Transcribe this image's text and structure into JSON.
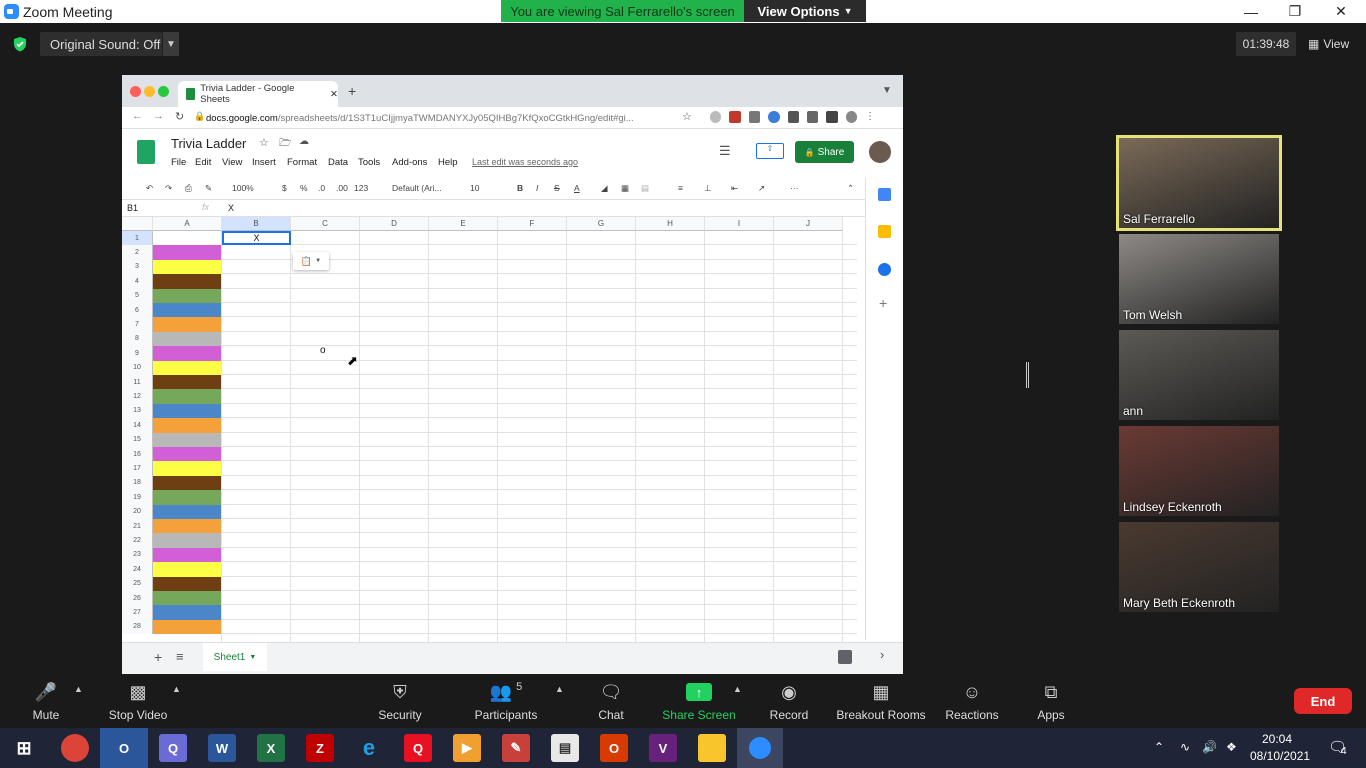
{
  "window": {
    "title": "Zoom Meeting",
    "minimize": "—",
    "maximize": "❐",
    "close": "✕"
  },
  "banner": {
    "viewing": "You are viewing Sal Ferrarello's screen",
    "view_options": "View Options"
  },
  "topbar": {
    "original_sound": "Original Sound: Off",
    "timer": "01:39:48",
    "view": "View"
  },
  "browser": {
    "tab_title": "Trivia Ladder - Google Sheets",
    "url_host": "docs.google.com",
    "url_path": "/spreadsheets/d/1S3T1uCIjjmyaTWMDANYXJy05QIHBg7KfQxoCGtkHGng/edit#gi..."
  },
  "sheets": {
    "title": "Trivia Ladder",
    "menus": [
      "File",
      "Edit",
      "View",
      "Insert",
      "Format",
      "Data",
      "Tools",
      "Add-ons",
      "Help"
    ],
    "last_edit": "Last edit was seconds ago",
    "share": "Share",
    "toolbar": {
      "zoom": "100%",
      "currency": "$",
      "percent": "%",
      "dec_less": ".0",
      "dec_more": ".00",
      "format": "123",
      "font": "Default (Ari...",
      "size": "10"
    },
    "name_box": "B1",
    "formula": "X",
    "columns": [
      "A",
      "B",
      "C",
      "D",
      "E",
      "F",
      "G",
      "H",
      "I",
      "J"
    ],
    "cell_b1": "X",
    "cell_c9": "o",
    "sheet_tab": "Sheet1",
    "row_colors": [
      "#ffffff",
      "#d35fd6",
      "#fcff44",
      "#6e3f13",
      "#76a85b",
      "#4a86c8",
      "#f4a13b",
      "#b8b8b8",
      "#d35fd6",
      "#fcff44",
      "#6e3f13",
      "#76a85b",
      "#4a86c8",
      "#f4a13b",
      "#b8b8b8",
      "#d35fd6",
      "#fcff44",
      "#6e3f13",
      "#76a85b",
      "#4a86c8",
      "#f4a13b",
      "#b8b8b8",
      "#d35fd6",
      "#fcff44",
      "#6e3f13",
      "#76a85b",
      "#4a86c8",
      "#f4a13b"
    ]
  },
  "participants": [
    {
      "name": "Sal Ferrarello",
      "active": true
    },
    {
      "name": "Tom Welsh"
    },
    {
      "name": "ann"
    },
    {
      "name": "Lindsey Eckenroth"
    },
    {
      "name": "Mary Beth Eckenroth"
    }
  ],
  "controls": {
    "mute": "Mute",
    "stop_video": "Stop Video",
    "security": "Security",
    "participants": "Participants",
    "participants_count": "5",
    "chat": "Chat",
    "share_screen": "Share Screen",
    "record": "Record",
    "breakout": "Breakout Rooms",
    "reactions": "Reactions",
    "apps": "Apps",
    "end": "End"
  },
  "taskbar": {
    "time": "20:04",
    "date": "08/10/2021",
    "notifications": "4"
  },
  "colors": {
    "zoom_green": "#21b24b",
    "end_red": "#e02828",
    "sheets_green": "#188038",
    "active_speaker": "#e6e27a"
  }
}
